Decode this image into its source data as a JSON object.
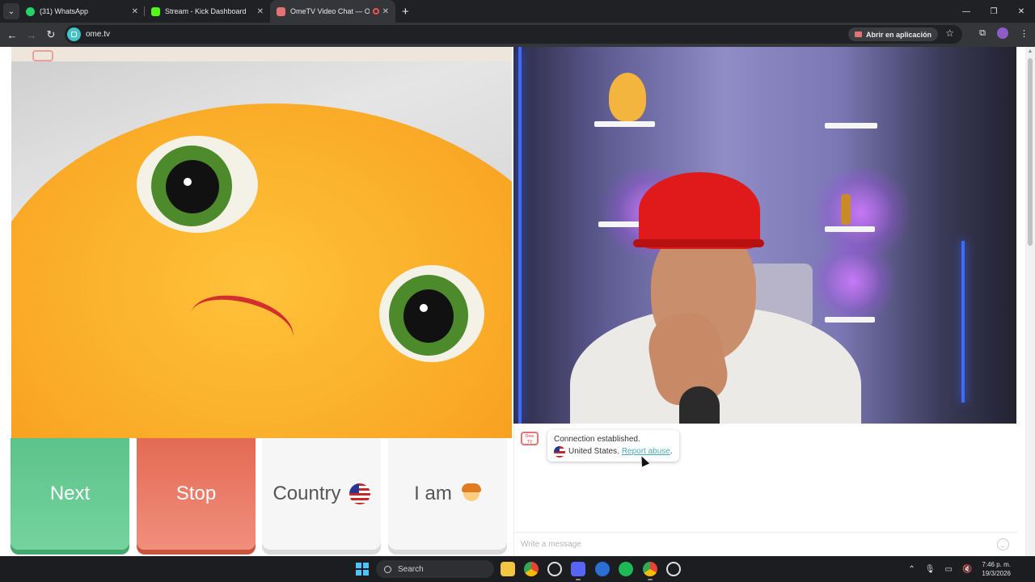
{
  "browser": {
    "tabs": [
      {
        "title": "(31) WhatsApp",
        "favicon_color": "#25d366",
        "active": false
      },
      {
        "title": "Stream - Kick Dashboard",
        "favicon_color": "#53fc18",
        "active": false
      },
      {
        "title": "OmeTV Video Chat — Ome",
        "favicon_color": "#e57373",
        "active": true
      }
    ],
    "url": "ome.tv",
    "open_in_app_label": "Abrir en aplicación"
  },
  "controls": {
    "next_label": "Next",
    "stop_label": "Stop",
    "country_label": "Country",
    "iam_label": "I am",
    "next_color": "#5bc38a",
    "stop_color": "#e46a55"
  },
  "chat": {
    "logo_text": "Ome TV",
    "message_line1": "Connection established.",
    "country": "United States.",
    "report_link": "Report abuse",
    "input_placeholder": "Write a message"
  },
  "taskbar": {
    "search_placeholder": "Search",
    "time": "7:46 p. m.",
    "date": "19/3/2026"
  }
}
